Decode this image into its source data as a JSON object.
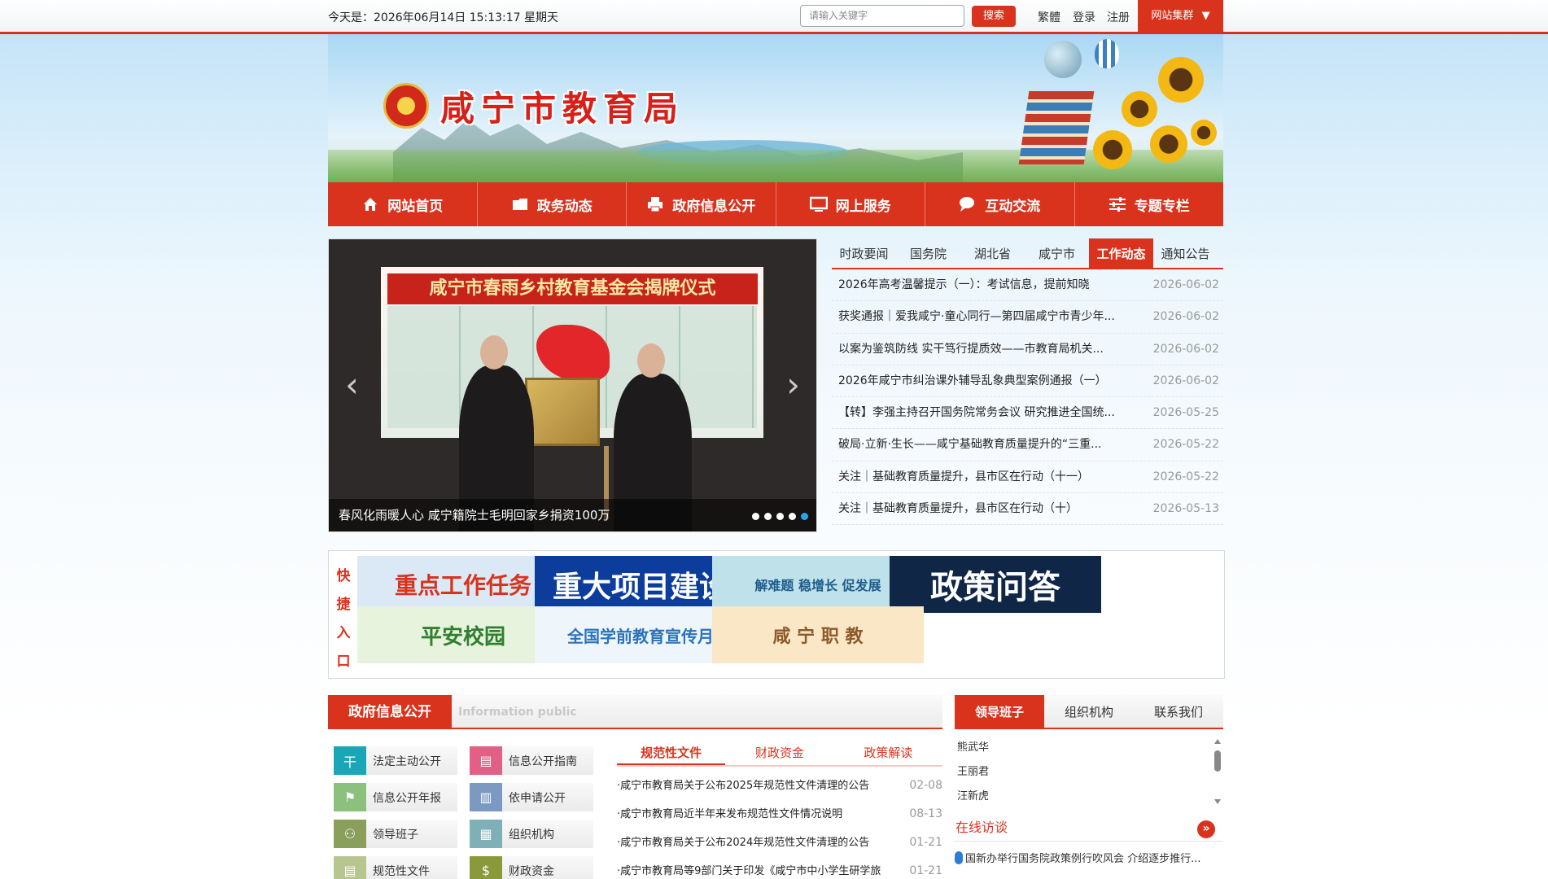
{
  "topbar": {
    "date_text": "今天是：2026年06月14日  15:13:17  星期天",
    "search_placeholder": "请输入关键字",
    "search_button": "搜索",
    "traditional": "繁體",
    "login": "登录",
    "register": "注册",
    "site_group": "网站集群"
  },
  "banner": {
    "title": "咸宁市教育局"
  },
  "nav": [
    {
      "label": "网站首页",
      "icon": "home-icon"
    },
    {
      "label": "政务动态",
      "icon": "folder-icon"
    },
    {
      "label": "政府信息公开",
      "icon": "printer-icon"
    },
    {
      "label": "网上服务",
      "icon": "monitor-icon"
    },
    {
      "label": "互动交流",
      "icon": "chat-icon"
    },
    {
      "label": "专题专栏",
      "icon": "sliders-icon"
    }
  ],
  "slider": {
    "headline": "咸宁市春雨乡村教育基金会揭牌仪式",
    "caption": "春风化雨暖人心 咸宁籍院士毛明回家乡捐资100万",
    "total_slides": 5,
    "active_slide": 5
  },
  "news": {
    "tabs": [
      "时政要闻",
      "国务院",
      "湖北省",
      "咸宁市",
      "工作动态",
      "通知公告"
    ],
    "active_tab": "工作动态",
    "items": [
      {
        "title": "2026年高考温馨提示（一）：考试信息，提前知晓",
        "date": "2026-06-02"
      },
      {
        "title": "获奖通报｜爱我咸宁·童心同行—第四届咸宁市青少年...",
        "date": "2026-06-02"
      },
      {
        "title": "以案为鉴筑防线 实干笃行提质效——市教育局机关...",
        "date": "2026-06-02"
      },
      {
        "title": "2026年咸宁市纠治课外辅导乱象典型案例通报（一）",
        "date": "2026-06-02"
      },
      {
        "title": "【转】李强主持召开国务院常务会议 研究推进全国统...",
        "date": "2026-05-25"
      },
      {
        "title": "破局·立新·生长——咸宁基础教育质量提升的“三重...",
        "date": "2026-05-22"
      },
      {
        "title": "关注｜基础教育质量提升，县市区在行动（十一）",
        "date": "2026-05-22"
      },
      {
        "title": "关注｜基础教育质量提升，县市区在行动（十）",
        "date": "2026-05-13"
      }
    ]
  },
  "quick": {
    "label": [
      "快",
      "捷",
      "入",
      "口"
    ],
    "tiles": [
      {
        "text": "重点工作任务",
        "bg": "#dbe9f6",
        "fg": "#d9331e"
      },
      {
        "text": "重大项目建设",
        "bg": "#0c3d9c",
        "fg": "#ffffff"
      },
      {
        "text": "解难题 稳增长 促发展",
        "bg": "#bfe2ea",
        "fg": "#1d5c8c"
      },
      {
        "text": "政策问答",
        "bg": "#0f2647",
        "fg": "#ffffff"
      },
      {
        "text": "平安校园",
        "bg": "#e7f3dd",
        "fg": "#2f7f2f"
      },
      {
        "text": "全国学前教育宣传月",
        "bg": "#eef5fb",
        "fg": "#2b73bb"
      },
      {
        "text": "咸 宁 职 教",
        "bg": "#f9e7c6",
        "fg": "#8d5a2b"
      }
    ]
  },
  "gov": {
    "title": "政府信息公开",
    "subtitle_en": "Information public",
    "buttons": [
      {
        "label": "法定主动公开",
        "icon": "tree-icon",
        "color": "#19a6b6"
      },
      {
        "label": "信息公开指南",
        "icon": "document-icon",
        "color": "#e25f86"
      },
      {
        "label": "信息公开年报",
        "icon": "flag-icon",
        "color": "#8bc07d"
      },
      {
        "label": "依申请公开",
        "icon": "bar-chart-icon",
        "color": "#7b9ac2"
      },
      {
        "label": "领导班子",
        "icon": "people-icon",
        "color": "#8a9f5c"
      },
      {
        "label": "组织机构",
        "icon": "org-icon",
        "color": "#7fb0b8"
      },
      {
        "label": "规范性文件",
        "icon": "file-icon",
        "color": "#b7c58e"
      },
      {
        "label": "财政资金",
        "icon": "money-icon",
        "color": "#8a9a3a"
      }
    ],
    "subtabs": [
      "规范性文件",
      "财政资金",
      "政策解读"
    ],
    "active_subtab": "规范性文件",
    "docs": [
      {
        "title": "·咸宁市教育局关于公布2025年规范性文件清理的公告",
        "date": "02-08"
      },
      {
        "title": "·咸宁市教育局近半年来发布规范性文件情况说明",
        "date": "08-13"
      },
      {
        "title": "·咸宁市教育局关于公布2024年规范性文件清理的公告",
        "date": "01-21"
      },
      {
        "title": "·咸宁市教育局等9部门关于印发《咸宁市中小学生研学旅",
        "date": "01-21"
      }
    ]
  },
  "leaders": {
    "tabs": [
      "领导班子",
      "组织机构",
      "联系我们"
    ],
    "active_tab": "领导班子",
    "names": [
      "熊武华",
      "王丽君",
      "汪新虎"
    ],
    "online_title": "在线访谈",
    "online_item": "国新办举行国务院政策例行吹风会 介绍逐步推行..."
  },
  "colors": {
    "brand_red": "#d9331e",
    "slider_active_dot": "#2aa4e8"
  }
}
